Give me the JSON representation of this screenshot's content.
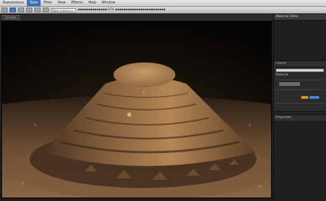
{
  "menubar": {
    "items": [
      "Nuovonexus",
      "Tools",
      "Filter",
      "View",
      "Effects",
      "Help",
      "Window"
    ]
  },
  "toolbar": {
    "field_text": "Base camera ▾",
    "status_text": "▪▪▪▪▪▪▪▪▪▪▪▪▪▪ BTR ▪▪▪▪▪▪▪▪▪▪▪▪▪▪▪▪▪▪▪▪▪▪▪▪"
  },
  "viewport": {
    "tab_label": "Render"
  },
  "right_panel": {
    "header": "Material Editor",
    "layers_label": "Layers",
    "property_label": "Material",
    "properties_label": "Properties"
  },
  "colors": {
    "accent_blue": "#3b6fb6",
    "chip_orange": "#d9932f",
    "chip_blue": "#4a86d0",
    "sand_light": "#b48655",
    "sand_dark": "#5a3e25"
  },
  "icons": [
    "move-icon",
    "rotate-icon",
    "scale-icon",
    "render-icon",
    "camera-icon",
    "light-icon"
  ]
}
